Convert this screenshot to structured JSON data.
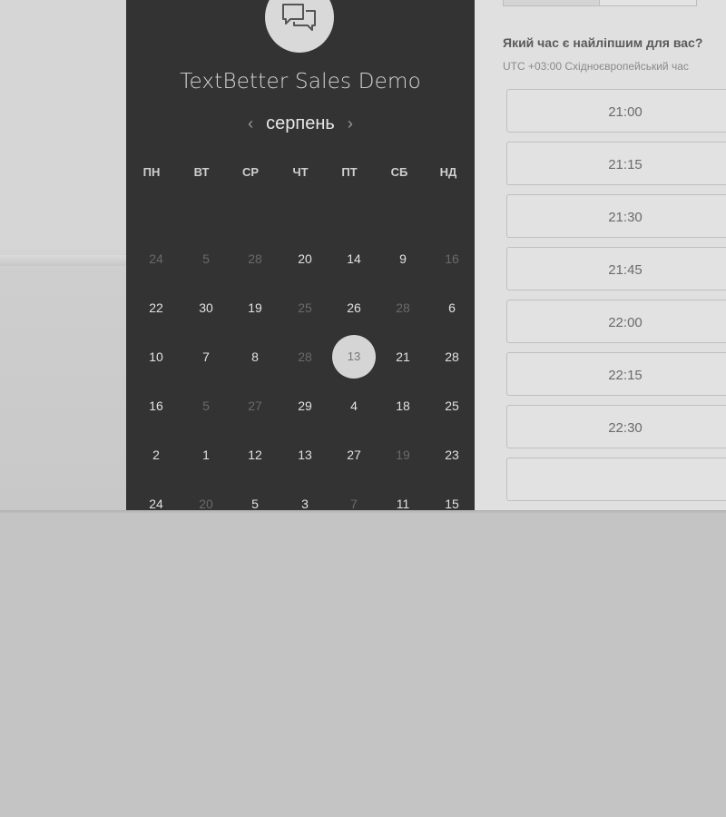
{
  "colors": {
    "backdrop": "#c4c4c4",
    "calendar_panel": "#333333",
    "times_panel": "#e0e0e0",
    "selected_day": "#d5d5d5"
  },
  "calendar": {
    "icon": "chat-bubbles-icon",
    "title": "TextBetter Sales Demo",
    "month": "серпень",
    "prev_icon": "chevron-left-icon",
    "next_icon": "chevron-right-icon",
    "weekdays": [
      "ПН",
      "ВТ",
      "СР",
      "ЧТ",
      "ПТ",
      "СБ",
      "НД"
    ],
    "weeks": [
      [
        {
          "d": "24",
          "muted": true
        },
        {
          "d": "5",
          "muted": true
        },
        {
          "d": "28",
          "muted": true
        },
        {
          "d": "20",
          "muted": false
        },
        {
          "d": "14",
          "muted": false
        },
        {
          "d": "9",
          "muted": false
        },
        {
          "d": "16",
          "muted": true
        }
      ],
      [
        {
          "d": "22",
          "muted": false
        },
        {
          "d": "30",
          "muted": false
        },
        {
          "d": "19",
          "muted": false
        },
        {
          "d": "25",
          "muted": true
        },
        {
          "d": "26",
          "muted": false
        },
        {
          "d": "28",
          "muted": true
        },
        {
          "d": "6",
          "muted": false
        }
      ],
      [
        {
          "d": "10",
          "muted": false
        },
        {
          "d": "7",
          "muted": false
        },
        {
          "d": "8",
          "muted": false
        },
        {
          "d": "28",
          "muted": true
        },
        {
          "d": "13",
          "muted": false,
          "selected": true
        },
        {
          "d": "21",
          "muted": false
        },
        {
          "d": "28",
          "muted": false
        }
      ],
      [
        {
          "d": "16",
          "muted": false
        },
        {
          "d": "5",
          "muted": true
        },
        {
          "d": "27",
          "muted": true
        },
        {
          "d": "29",
          "muted": false
        },
        {
          "d": "4",
          "muted": false
        },
        {
          "d": "18",
          "muted": false
        },
        {
          "d": "25",
          "muted": false
        }
      ],
      [
        {
          "d": "2",
          "muted": false
        },
        {
          "d": "1",
          "muted": false
        },
        {
          "d": "12",
          "muted": false
        },
        {
          "d": "13",
          "muted": false
        },
        {
          "d": "27",
          "muted": false
        },
        {
          "d": "19",
          "muted": true
        },
        {
          "d": "23",
          "muted": false
        }
      ],
      [
        {
          "d": "24",
          "muted": false
        },
        {
          "d": "20",
          "muted": true
        },
        {
          "d": "5",
          "muted": false
        },
        {
          "d": "3",
          "muted": false
        },
        {
          "d": "7",
          "muted": true
        },
        {
          "d": "11",
          "muted": false
        },
        {
          "d": "15",
          "muted": false
        }
      ]
    ]
  },
  "times": {
    "question": "Який час є найліпшим для вас?",
    "timezone": "UTC +03:00 Східноєвропейський час",
    "slots": [
      "21:00",
      "21:15",
      "21:30",
      "21:45",
      "22:00",
      "22:15",
      "22:30",
      ""
    ]
  }
}
